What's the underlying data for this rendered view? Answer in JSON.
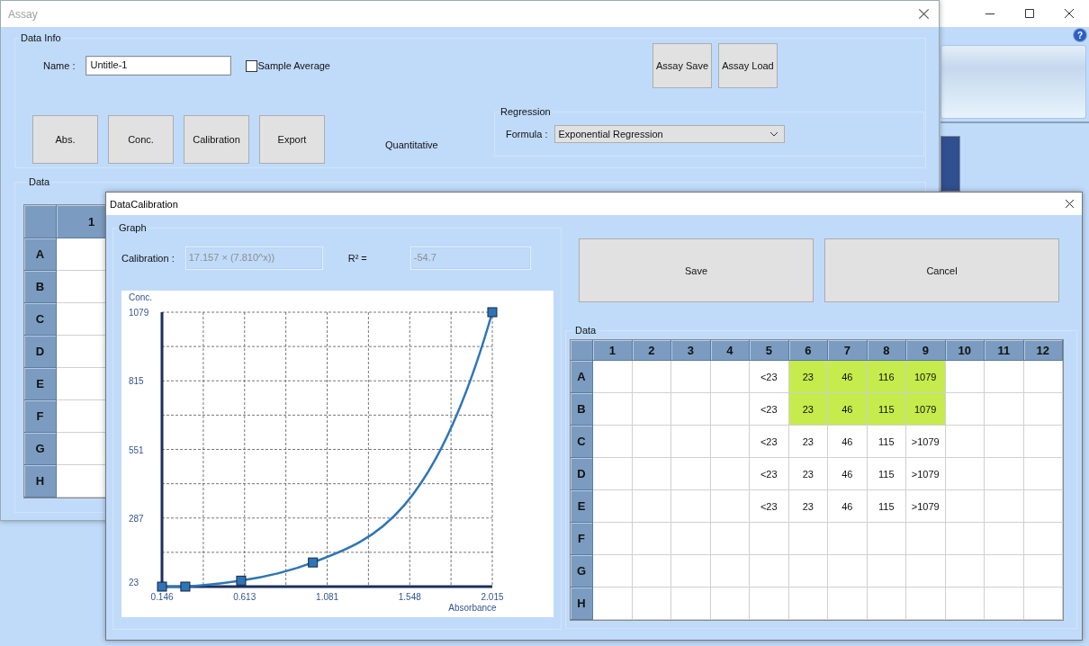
{
  "main_window": {
    "help": "?"
  },
  "assay_window": {
    "title": "Assay",
    "data_info": {
      "legend": "Data Info",
      "name_label": "Name :",
      "name_value": "Untitle-1",
      "sample_average": {
        "label": "Sample Average",
        "checked": false
      },
      "file_buttons": [
        "Assay Save",
        "Assay Load"
      ],
      "action_buttons": [
        "Abs.",
        "Conc.",
        "Calibration",
        "Export"
      ],
      "mode": "Quantitative",
      "regression": {
        "legend": "Regression",
        "formula_label": "Formula :",
        "formula": "Exponential Regression"
      }
    },
    "data": {
      "legend": "Data",
      "columns": [
        "1"
      ],
      "rows": [
        {
          "label": "A",
          "cells": [
            {
              "highlighted": false
            }
          ]
        },
        {
          "label": "B",
          "cells": [
            {
              "highlighted": false
            }
          ]
        },
        {
          "label": "C",
          "cells": [
            {
              "highlighted": false
            }
          ]
        },
        {
          "label": "D",
          "cells": [
            {
              "highlighted": false
            }
          ]
        },
        {
          "label": "E",
          "cells": [
            {
              "highlighted": false
            }
          ]
        },
        {
          "label": "F",
          "cells": [
            {
              "highlighted": false
            }
          ]
        },
        {
          "label": "G",
          "cells": [
            {
              "highlighted": false
            }
          ]
        },
        {
          "label": "H",
          "cells": [
            {
              "highlighted": false
            }
          ]
        }
      ]
    }
  },
  "calibration_dialog": {
    "title": "DataCalibration",
    "graph": {
      "legend": "Graph",
      "calibration_label": "Calibration :",
      "calibration": "17.157 × (7.810^x))",
      "r2_label": "R² =",
      "r2": "-54.7",
      "chart_data": {
        "type": "line",
        "xlabel": "Absorbance",
        "ylabel": "Conc.",
        "x": [
          0.146,
          0.278,
          0.594,
          1.0,
          2.015
        ],
        "series": [
          {
            "color": "#2e75b6",
            "marker": "square",
            "values": [
              23,
              23,
              46,
              116,
              1079
            ]
          }
        ],
        "xlim": [
          0.146,
          2.015
        ],
        "ylim": [
          23,
          1079
        ],
        "xticks": [
          0.146,
          0.613,
          1.081,
          1.548,
          2.015
        ],
        "yticks": [
          23,
          287,
          551,
          815,
          1079
        ],
        "grid": true
      }
    },
    "buttons": [
      "Save",
      "Cancel"
    ],
    "data": {
      "legend": "Data",
      "columns": [
        "1",
        "2",
        "3",
        "4",
        "5",
        "6",
        "7",
        "8",
        "9",
        "10",
        "11",
        "12"
      ],
      "rows": [
        {
          "label": "A",
          "cells": [
            {
              "highlighted": false
            },
            {
              "highlighted": false
            },
            {
              "highlighted": false
            },
            {
              "highlighted": false
            },
            {
              "value": "<23",
              "highlighted": false
            },
            {
              "value": "23",
              "highlighted": true
            },
            {
              "value": "46",
              "highlighted": true
            },
            {
              "value": "116",
              "highlighted": true
            },
            {
              "value": "1079",
              "highlighted": true
            },
            {
              "highlighted": false
            },
            {
              "highlighted": false
            },
            {
              "highlighted": false
            }
          ]
        },
        {
          "label": "B",
          "cells": [
            {
              "highlighted": false
            },
            {
              "highlighted": false
            },
            {
              "highlighted": false
            },
            {
              "highlighted": false
            },
            {
              "value": "<23",
              "highlighted": false
            },
            {
              "value": "23",
              "highlighted": true
            },
            {
              "value": "46",
              "highlighted": true
            },
            {
              "value": "115",
              "highlighted": true
            },
            {
              "value": "1079",
              "highlighted": true
            },
            {
              "highlighted": false
            },
            {
              "highlighted": false
            },
            {
              "highlighted": false
            }
          ]
        },
        {
          "label": "C",
          "cells": [
            {
              "highlighted": false
            },
            {
              "highlighted": false
            },
            {
              "highlighted": false
            },
            {
              "highlighted": false
            },
            {
              "value": "<23",
              "highlighted": false
            },
            {
              "value": "23",
              "highlighted": false
            },
            {
              "value": "46",
              "highlighted": false
            },
            {
              "value": "115",
              "highlighted": false
            },
            {
              "value": ">1079",
              "highlighted": false
            },
            {
              "highlighted": false
            },
            {
              "highlighted": false
            },
            {
              "highlighted": false
            }
          ]
        },
        {
          "label": "D",
          "cells": [
            {
              "highlighted": false
            },
            {
              "highlighted": false
            },
            {
              "highlighted": false
            },
            {
              "highlighted": false
            },
            {
              "value": "<23",
              "highlighted": false
            },
            {
              "value": "23",
              "highlighted": false
            },
            {
              "value": "46",
              "highlighted": false
            },
            {
              "value": "115",
              "highlighted": false
            },
            {
              "value": ">1079",
              "highlighted": false
            },
            {
              "highlighted": false
            },
            {
              "highlighted": false
            },
            {
              "highlighted": false
            }
          ]
        },
        {
          "label": "E",
          "cells": [
            {
              "highlighted": false
            },
            {
              "highlighted": false
            },
            {
              "highlighted": false
            },
            {
              "highlighted": false
            },
            {
              "value": "<23",
              "highlighted": false
            },
            {
              "value": "23",
              "highlighted": false
            },
            {
              "value": "46",
              "highlighted": false
            },
            {
              "value": "115",
              "highlighted": false
            },
            {
              "value": ">1079",
              "highlighted": false
            },
            {
              "highlighted": false
            },
            {
              "highlighted": false
            },
            {
              "highlighted": false
            }
          ]
        },
        {
          "label": "F",
          "cells": [
            {
              "highlighted": false
            },
            {
              "highlighted": false
            },
            {
              "highlighted": false
            },
            {
              "highlighted": false
            },
            {
              "highlighted": false
            },
            {
              "highlighted": false
            },
            {
              "highlighted": false
            },
            {
              "highlighted": false
            },
            {
              "highlighted": false
            },
            {
              "highlighted": false
            },
            {
              "highlighted": false
            },
            {
              "highlighted": false
            }
          ]
        },
        {
          "label": "G",
          "cells": [
            {
              "highlighted": false
            },
            {
              "highlighted": false
            },
            {
              "highlighted": false
            },
            {
              "highlighted": false
            },
            {
              "highlighted": false
            },
            {
              "highlighted": false
            },
            {
              "highlighted": false
            },
            {
              "highlighted": false
            },
            {
              "highlighted": false
            },
            {
              "highlighted": false
            },
            {
              "highlighted": false
            },
            {
              "highlighted": false
            }
          ]
        },
        {
          "label": "H",
          "cells": [
            {
              "highlighted": false
            },
            {
              "highlighted": false
            },
            {
              "highlighted": false
            },
            {
              "highlighted": false
            },
            {
              "highlighted": false
            },
            {
              "highlighted": false
            },
            {
              "highlighted": false
            },
            {
              "highlighted": false
            },
            {
              "highlighted": false
            },
            {
              "highlighted": false
            },
            {
              "highlighted": false
            },
            {
              "highlighted": false
            }
          ]
        }
      ]
    }
  }
}
